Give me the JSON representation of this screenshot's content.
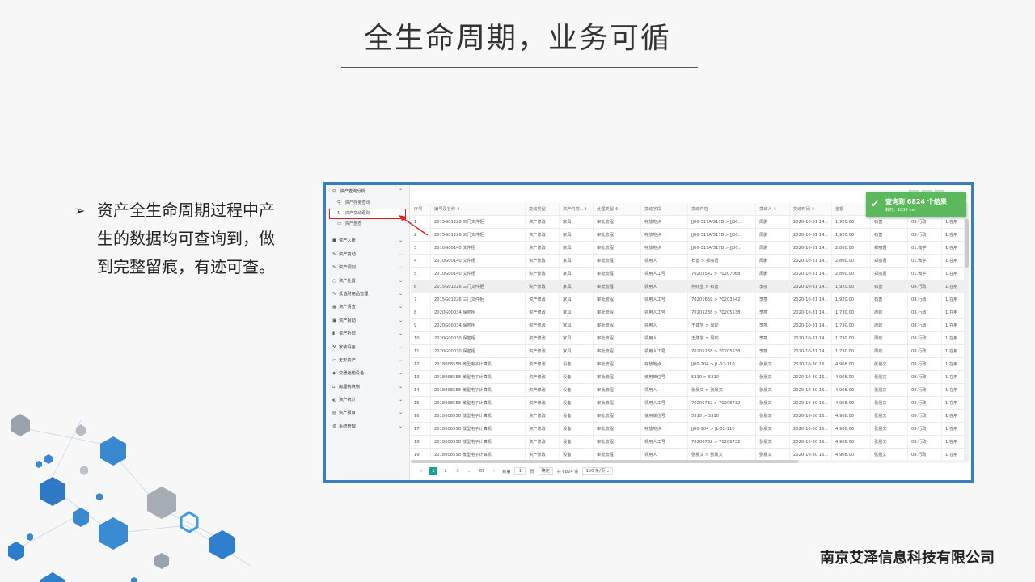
{
  "slide": {
    "title": "全生命周期，业务可循",
    "bullet_mark": "➢",
    "bullet_text": "资产全生命周期过程中产生的数据均可查询到，做到完整留痕，有迹可查。",
    "company": "南京艾泽信息科技有限公司"
  },
  "sidebar": {
    "group_title": "资产查询分析",
    "sub_items": [
      {
        "icon": "search-icon",
        "label": "资产存量查询"
      },
      {
        "icon": "refresh-icon",
        "label": "资产变动跟踪"
      },
      {
        "icon": "calendar-icon",
        "label": "资产盘查"
      }
    ],
    "items": [
      {
        "icon": "folder-icon",
        "label": "资产入账"
      },
      {
        "icon": "pencil-icon",
        "label": "资产变动"
      },
      {
        "icon": "pencil-icon",
        "label": "资产调剂"
      },
      {
        "icon": "circle-icon",
        "label": "资产处置"
      },
      {
        "icon": "pencil-icon",
        "label": "低值耐用品管理"
      },
      {
        "icon": "grid-icon",
        "label": "资产清查"
      },
      {
        "icon": "image-icon",
        "label": "资产报动"
      },
      {
        "icon": "book-icon",
        "label": "资产折旧"
      },
      {
        "icon": "wrench-icon",
        "label": "家装设备"
      },
      {
        "icon": "monitor-icon",
        "label": "无形资产"
      },
      {
        "icon": "car-icon",
        "label": "交通运输设备"
      },
      {
        "icon": "home-icon",
        "label": "房屋构筑物"
      },
      {
        "icon": "pie-icon",
        "label": "资产统计"
      },
      {
        "icon": "table-icon",
        "label": "资产报目"
      },
      {
        "icon": "gear-icon",
        "label": "系统管理"
      }
    ]
  },
  "table": {
    "headers": [
      "序号",
      "编号及名称 ⇕",
      "变动类型",
      "资产内容...⇕",
      "处理类型 ⇕",
      "变动字段",
      "变动内容",
      "变动人 ⇕",
      "变动时间 ⇕",
      "金额",
      "",
      "",
      ""
    ],
    "rows": [
      [
        "1",
        "2015G01226 三门文件柜",
        "资产修改",
        "家具",
        "审批流程",
        "存放地点",
        "JJ00-317A/317B > JJ00...",
        "周鹏",
        "2020-10-31 14...",
        "1,920.00",
        "石善",
        "08.行政",
        "1.在用"
      ],
      [
        "2",
        "2015G01226 三门文件柜",
        "资产修改",
        "家具",
        "审批流程",
        "存放地点",
        "JJ00-317A/317B > JJ00...",
        "周鹏",
        "2020-10-31 14...",
        "1,920.00",
        "石善",
        "08.行政",
        "1.在用"
      ],
      [
        "3",
        "2010G00140 文件柜",
        "资产修改",
        "家具",
        "审批流程",
        "存放地点",
        "JJ00-317A/317B > JJ00...",
        "周鹏",
        "2020-10-31 14...",
        "2,800.00",
        "郑丽君",
        "01.教学",
        "1.在用"
      ],
      [
        "4",
        "2010G00140 文件柜",
        "资产修改",
        "家具",
        "审批流程",
        "领用人",
        "石善 > 郑丽君",
        "周鹏",
        "2020-10-31 14...",
        "2,800.00",
        "郑丽君",
        "01.教学",
        "1.在用"
      ],
      [
        "5",
        "2010G00140 文件柜",
        "资产修改",
        "家具",
        "审批流程",
        "领用人工号",
        "70203542 > 70207068",
        "周鹏",
        "2020-10-31 14...",
        "2,800.00",
        "郑丽君",
        "01.教学",
        "1.在用"
      ],
      [
        "6",
        "2015G01226 三门文件柜",
        "资产修改",
        "家具",
        "审批流程",
        "领用人",
        "何晓业 > 石善",
        "李丽",
        "2020-10-31 14...",
        "1,920.00",
        "石善",
        "08.行政",
        "1.在用"
      ],
      [
        "7",
        "2015G01226 三门文件柜",
        "资产修改",
        "家具",
        "审批流程",
        "领用人工号",
        "70201669 > 70203542",
        "李丽",
        "2020-10-31 14...",
        "1,920.00",
        "石善",
        "08.行政",
        "1.在用"
      ],
      [
        "8",
        "2020G00034 保密柜",
        "资产修改",
        "家具",
        "审批流程",
        "领用人工号",
        "70205238 > 70205538",
        "李丽",
        "2020-10-31 14...",
        "1,730.00",
        "周劲",
        "08.行政",
        "1.在用"
      ],
      [
        "9",
        "2020G00034 保密柜",
        "资产修改",
        "家具",
        "审批流程",
        "领用人",
        "王建学 > 周劲",
        "李丽",
        "2020-10-31 14...",
        "1,730.00",
        "周劲",
        "08.行政",
        "1.在用"
      ],
      [
        "10",
        "2020G00030 保密柜",
        "资产修改",
        "家具",
        "审批流程",
        "领用人",
        "王建学 > 周劲",
        "李丽",
        "2020-10-31 14...",
        "1,730.00",
        "周劲",
        "08.行政",
        "1.在用"
      ],
      [
        "11",
        "2020G00030 保密柜",
        "资产修改",
        "家具",
        "审批流程",
        "领用人工号",
        "70205238 > 70205538",
        "李丽",
        "2020-10-31 14...",
        "1,730.00",
        "周劲",
        "08.行政",
        "1.在用"
      ],
      [
        "12",
        "2018008558 微型电子计算机",
        "资产修改",
        "设备",
        "审批流程",
        "存放地点",
        "JJ00-104 > JL-02-110",
        "张晨文",
        "2020-10-30 16...",
        "4,908.00",
        "张晨文",
        "08.行政",
        "1.在用"
      ],
      [
        "13",
        "2018008558 微型电子计算机",
        "资产修改",
        "设备",
        "审批流程",
        "使用单位号",
        "5310 > 5310",
        "张晨文",
        "2020-10-30 16...",
        "4,908.00",
        "张晨文",
        "08.行政",
        "1.在用"
      ],
      [
        "14",
        "2018008558 微型电子计算机",
        "资产修改",
        "设备",
        "审批流程",
        "领用人",
        "张晨文 > 张晨文",
        "张晨文",
        "2020-10-30 16...",
        "4,908.00",
        "张晨文",
        "08.行政",
        "1.在用"
      ],
      [
        "15",
        "2018008558 微型电子计算机",
        "资产修改",
        "设备",
        "审批流程",
        "领用人工号",
        "70206732 > 70206732",
        "张晨文",
        "2020-10-30 16...",
        "4,908.00",
        "张晨文",
        "08.行政",
        "1.在用"
      ],
      [
        "16",
        "2018008558 微型电子计算机",
        "资产修改",
        "设备",
        "审批流程",
        "使用单位号",
        "5310 > 5310",
        "张晨文",
        "2020-10-30 16...",
        "4,908.00",
        "张晨文",
        "08.行政",
        "1.在用"
      ],
      [
        "17",
        "2018008558 微型电子计算机",
        "资产修改",
        "设备",
        "审批流程",
        "存放地点",
        "JJ00-104 > JL-02-110",
        "张晨文",
        "2020-10-30 16...",
        "4,908.00",
        "张晨文",
        "08.行政",
        "1.在用"
      ],
      [
        "18",
        "2018008558 微型电子计算机",
        "资产修改",
        "设备",
        "审批流程",
        "领用人工号",
        "70206732 > 70206732",
        "张晨文",
        "2020-10-30 16...",
        "4,908.00",
        "张晨文",
        "08.行政",
        "1.在用"
      ],
      [
        "19",
        "2018008558 微型电子计算机",
        "资产修改",
        "设备",
        "审批流程",
        "领用人",
        "张晨文 > 张晨文",
        "张晨文",
        "2020-10-30 16...",
        "4,908.00",
        "张晨文",
        "08.行政",
        "1.在用"
      ]
    ],
    "selected_row": 5
  },
  "pager": {
    "prev": "‹",
    "pages": [
      "1",
      "2",
      "3",
      "...",
      "69"
    ],
    "current": "1",
    "next": "›",
    "goto_label": "到第",
    "goto_value": "1",
    "page_unit": "页",
    "confirm": "确定",
    "total": "共 6824 条",
    "page_size": "100 条/页 ⌄"
  },
  "toast": {
    "title": "查询到 6824 个结果",
    "subtitle": "耗时：1838 ms",
    "color": "#5cb85c"
  },
  "colors": {
    "frame": "#3a7dc0",
    "accent": "#1aa094",
    "highlight": "#e02020"
  }
}
